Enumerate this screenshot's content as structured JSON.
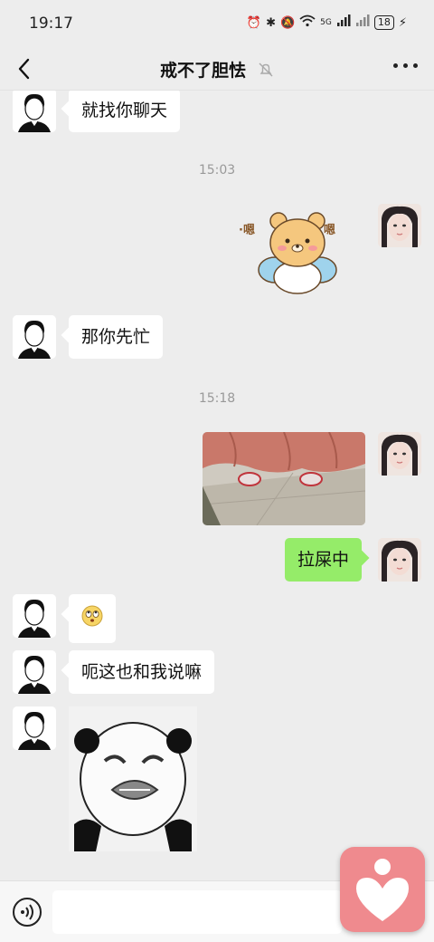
{
  "status_bar": {
    "time": "19:17",
    "network": "5G",
    "battery": "18"
  },
  "header": {
    "title": "戒不了胆怯",
    "back_icon": "chevron-left-icon",
    "mute_icon": "bell-off-icon",
    "more_icon": "more-dots-icon"
  },
  "messages": [
    {
      "side": "left",
      "type": "text",
      "text": "就找你聊天"
    },
    {
      "type": "time",
      "text": "15:03"
    },
    {
      "side": "right",
      "type": "sticker",
      "sticker": "bear-sticker"
    },
    {
      "side": "left",
      "type": "text",
      "text": "那你先忙"
    },
    {
      "type": "time",
      "text": "15:18"
    },
    {
      "side": "right",
      "type": "image",
      "image": "photo-feet"
    },
    {
      "side": "right",
      "type": "text",
      "text": "拉屎中"
    },
    {
      "side": "left",
      "type": "emoji",
      "emoji": "🙄"
    },
    {
      "side": "left",
      "type": "text",
      "text": "呃这也和我说嘛"
    },
    {
      "side": "left",
      "type": "sticker",
      "sticker": "panda-meme-sticker"
    }
  ],
  "input_bar": {
    "voice_icon": "voice-icon",
    "placeholder": ""
  },
  "colors": {
    "background": "#ededed",
    "sent_bubble": "#95ec69",
    "received_bubble": "#ffffff",
    "floating_app": "#ef8a8e"
  }
}
